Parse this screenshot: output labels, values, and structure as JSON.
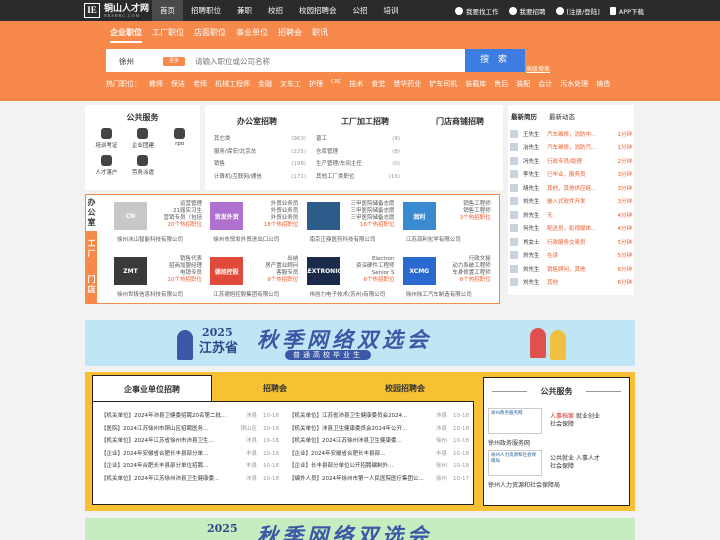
{
  "site": {
    "logo_mark": "IE",
    "name": "铜山人才网",
    "sub": "NRSHRC.COM"
  },
  "topnav": [
    "首页",
    "招聘职位",
    "兼职",
    "校招",
    "校园招聘会",
    "公招",
    "培训"
  ],
  "topright": {
    "find_job": "我要找工作",
    "hire": "我要招聘",
    "login": "[注册/登陆]",
    "app": "APP下载"
  },
  "search": {
    "tabs": [
      "企业职位",
      "工厂职位",
      "店面职位",
      "事业单位",
      "招聘会",
      "职讯"
    ],
    "city": "徐州",
    "change": "更多",
    "placeholder": "请输入职位或公司名称",
    "button": "搜 索",
    "advanced": "高级搜索"
  },
  "hot": {
    "label": "热门职位：",
    "items": [
      "教师",
      "保洁",
      "老师",
      "机械工程师",
      "金融",
      "叉车工",
      "护理",
      "CRC",
      "技术",
      "食堂",
      "慧华药业",
      "铲车司机",
      "装载库",
      "售后",
      "装配",
      "会计",
      "污水处理",
      "铸造"
    ]
  },
  "services": {
    "title": "公共服务",
    "items": [
      "培训考证",
      "企业团建",
      "rpo",
      "人才落户",
      "劳务派遣"
    ]
  },
  "office": {
    "title": "办公室招聘",
    "rows": [
      {
        "t": "其它类",
        "n": "(963)"
      },
      {
        "t": "服务/保安/北京总",
        "n": "(225)"
      },
      {
        "t": "销售",
        "n": "(198)"
      },
      {
        "t": "计算机/互联网/通信",
        "n": "(171)"
      }
    ]
  },
  "factory": {
    "title": "工厂加工招聘",
    "rows": [
      {
        "t": "普工",
        "n": "(9)"
      },
      {
        "t": "仓库管理",
        "n": "(8)"
      },
      {
        "t": "生产管理/车间主任",
        "n": "(0)"
      },
      {
        "t": "其他工厂类职位",
        "n": "(16)"
      }
    ]
  },
  "shop": {
    "title": "门店商铺招聘"
  },
  "news": {
    "tabs": [
      "最新简历",
      "最新动态"
    ],
    "rows": [
      {
        "n": "王先生",
        "t": "汽车维修，消防中...",
        "m": "1分钟"
      },
      {
        "n": "冶先生",
        "t": "汽车维修，消防汽...",
        "m": "1分钟"
      },
      {
        "n": "冯先生",
        "t": "行政专员/助理",
        "m": "2分钟"
      },
      {
        "n": "李先生",
        "t": "已毕业，服务员",
        "m": "3分钟"
      },
      {
        "n": "胡先生",
        "t": "其他，其他供应链...",
        "m": "3分钟"
      },
      {
        "n": "刘先生",
        "t": "嵌入式软件开发",
        "m": "3分钟"
      },
      {
        "n": "刘先生",
        "t": "无",
        "m": "4分钟"
      },
      {
        "n": "何先生",
        "t": "配送员，影视媒体...",
        "m": "4分钟"
      },
      {
        "n": "肖女士",
        "t": "行政服务交易员",
        "m": "5分钟"
      },
      {
        "n": "刘先生",
        "t": "在读",
        "m": "5分钟"
      },
      {
        "n": "刘先生",
        "t": "销售顾问，其他",
        "m": "6分钟"
      },
      {
        "n": "刘先生",
        "t": "其他",
        "m": "6分钟"
      }
    ]
  },
  "corp_tabs": [
    "办公室",
    "工厂",
    "门店"
  ],
  "corps": [
    {
      "logo": "CN",
      "jobs": [
        "运营管理",
        "21届实习生",
        "营销专员（包括",
        "20个热招职位"
      ],
      "name": "徐州冰山智能科技有限公司",
      "color": "#c8c8c8"
    },
    {
      "logo": "贸发外贸",
      "jobs": [
        "外贸业务员",
        "外贸业务员",
        "外贸业务员",
        "18个热招职位"
      ],
      "name": "徐州市贸发外贸进出口公司",
      "color": "#b070d0"
    },
    {
      "logo": "",
      "jobs": [
        "三甲医院储备志愿",
        "三甲医院储备志愿",
        "三甲医院储备志愿",
        "16个热招职位"
      ],
      "name": "南京正鼎医药科技有限公司",
      "color": "#2b5c8a"
    },
    {
      "logo": "润利",
      "jobs": [
        "销售工程师",
        "销售工程师",
        "3个热招职位"
      ],
      "name": "江苏润利化学有限公司",
      "color": "#3a8ad0"
    },
    {
      "logo": "ZMT",
      "jobs": [
        "销售代表",
        "招商加盟经理",
        "电销专员",
        "10个热招职位"
      ],
      "name": "徐州世极信息科技有限公司",
      "color": "#3a3a3a"
    },
    {
      "logo": "德旭控股",
      "jobs": [
        "出纳",
        "房产置业顾问",
        "客服专员",
        "9个热招职位"
      ],
      "name": "江苏德旭控股集团有限公司",
      "color": "#e04a3a"
    },
    {
      "logo": "FLEXTRONICS",
      "jobs": [
        "Electron",
        "资深硬件工程师",
        "Senior S",
        "6个热招职位"
      ],
      "name": "伟创力电子技术(苏州)有限公司",
      "color": "#1a2a4a"
    },
    {
      "logo": "XCMG",
      "jobs": [
        "行政文秘",
        "动力系统工程师",
        "车身修置工程师",
        "6个热招职位"
      ],
      "name": "徐州徐工汽车制造有限公司",
      "color": "#2a6ad0"
    }
  ],
  "banner1": {
    "year": "2025",
    "province": "江苏省",
    "main": "秋季网络双选会",
    "sub": "普通高校毕业生"
  },
  "public_tabs": [
    "企事业单位招聘",
    "招聘会",
    "校园招聘会"
  ],
  "public_left": [
    {
      "t": "【机关单位】2024年沛县卫健委招聘20名第二批...",
      "c": "沛县",
      "d": "10-18"
    },
    {
      "t": "【医院】2024江苏徐州市铜山区招聘医务...",
      "c": "铜山区",
      "d": "10-18"
    },
    {
      "t": "【机关单位】2024年江苏省徐州市沛县卫生...",
      "c": "沛县",
      "d": "10-18"
    },
    {
      "t": "【企业】2024年安徽省合肥长丰县部分单...",
      "c": "丰县",
      "d": "10-18"
    },
    {
      "t": "【企业】2024年合肥长丰县部分单位招聘...",
      "c": "丰县",
      "d": "10-18"
    },
    {
      "t": "【机关单位】2024年江苏徐州沛县卫生健康委...",
      "c": "沛县",
      "d": "10-18"
    }
  ],
  "public_right": [
    {
      "t": "【机关单位】江苏省沛县卫生健康委员会2024...",
      "c": "沛县",
      "d": "10-18"
    },
    {
      "t": "【机关单位】沛县卫生健康委员会2024年公开...",
      "c": "沛县",
      "d": "10-18"
    },
    {
      "t": "【机关单位】2024江苏徐州沛县卫生健康委...",
      "c": "徐州",
      "d": "10-18"
    },
    {
      "t": "【企业】2024年安徽省合肥长丰县部...",
      "c": "丰县",
      "d": "10-18"
    },
    {
      "t": "【企业】长丰县部分单位公开招聘编制外...",
      "c": "徐州",
      "d": "10-18"
    },
    {
      "t": "【编外人员】2024年徐州市第一人民医院医疗集团公...",
      "c": "徐州",
      "d": "10-17"
    }
  ],
  "gov": {
    "title": "公共服务",
    "items": [
      {
        "logo": "徐州政务服务网",
        "r1a": "人事档案",
        "r1b": "就业创业",
        "r2": "社会保障",
        "name": "徐州政务服务网"
      },
      {
        "logo": "徐州人力资源和社会保障局",
        "r1a": "公共就业",
        "r1b": "人事人才",
        "r2": "社会保障",
        "name": "徐州人力资源和社会保障局"
      }
    ]
  }
}
